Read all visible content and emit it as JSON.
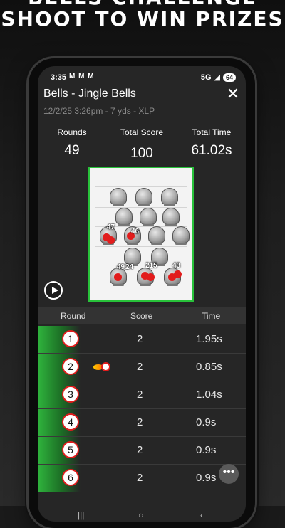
{
  "promo": {
    "line1": "BELLS CHALLENGE",
    "line2": "SHOOT TO WIN PRIZES"
  },
  "status": {
    "time": "3:35",
    "notif": "M M M",
    "signal": "5G",
    "battery": "64"
  },
  "header": {
    "title": "Bells - Jingle Bells",
    "subtitle": "12/2/25 3:26pm - 7 yds - XLP",
    "close_icon": "close-icon"
  },
  "stats": [
    {
      "label": "Rounds",
      "value": "49"
    },
    {
      "label": "Total Score",
      "value": "100"
    },
    {
      "label": "Total Time",
      "value": "61.02s"
    }
  ],
  "target": {
    "hit_labels": [
      "47",
      "46",
      "49",
      "24",
      "215",
      "43"
    ]
  },
  "table": {
    "headers": {
      "round": "Round",
      "score": "Score",
      "time": "Time"
    },
    "rows": [
      {
        "round": "1",
        "score": "2",
        "time": "1.95s"
      },
      {
        "round": "2",
        "score": "2",
        "time": "0.85s"
      },
      {
        "round": "3",
        "score": "2",
        "time": "1.04s"
      },
      {
        "round": "4",
        "score": "2",
        "time": "0.9s"
      },
      {
        "round": "5",
        "score": "2",
        "time": "0.9s"
      },
      {
        "round": "6",
        "score": "2",
        "time": "0.9s"
      }
    ]
  },
  "more_button": "•••",
  "nav": {
    "recents": "|||",
    "home": "○",
    "back": "‹"
  },
  "colors": {
    "accent_green": "#2fb43d",
    "hit_red": "#e21c1c",
    "screen_bg": "#262626"
  }
}
